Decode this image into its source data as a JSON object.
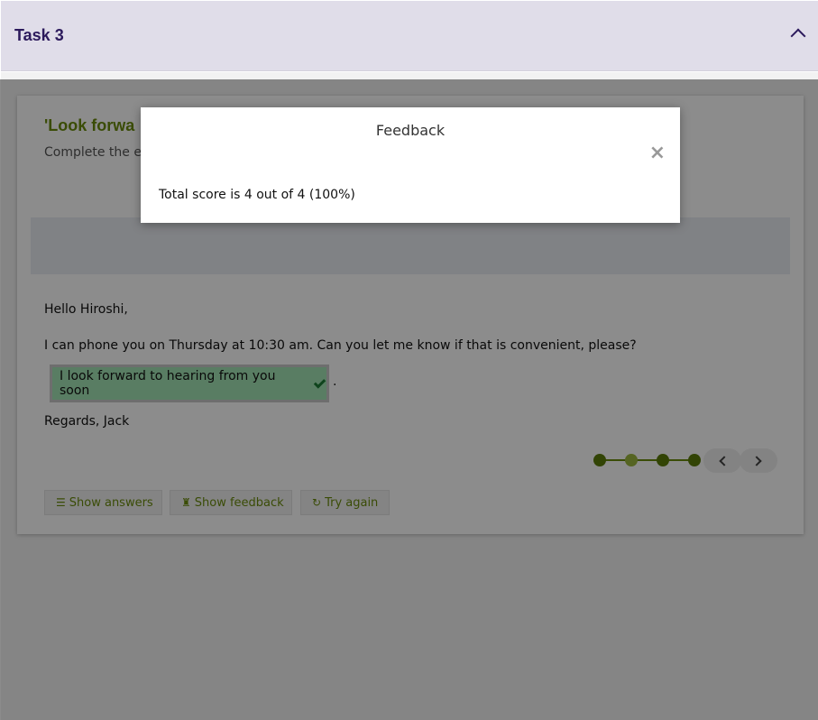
{
  "accordion": {
    "title": "Task 3"
  },
  "card": {
    "title": "'Look forwa",
    "subtitle": "Complete the em",
    "greeting": "Hello Hiroshi,",
    "body": "I can phone you on Thursday at 10:30 am. Can you let me know if that is convenient, please?",
    "answer": "I look forward to hearing from you soon",
    "period": ".",
    "signoff": "Regards, Jack"
  },
  "progress": {
    "steps": 4,
    "current": 4
  },
  "buttons": {
    "show_answers": "Show answers",
    "show_feedback": "Show feedback",
    "try_again": "Try again"
  },
  "modal": {
    "title": "Feedback",
    "close": "×",
    "message": "Total score is 4 out of 4 (100%)"
  },
  "icons": [
    "chevron-up-icon",
    "check-icon",
    "chevron-left-icon",
    "chevron-right-icon",
    "list-icon",
    "rook-icon",
    "refresh-icon",
    "close-icon"
  ]
}
